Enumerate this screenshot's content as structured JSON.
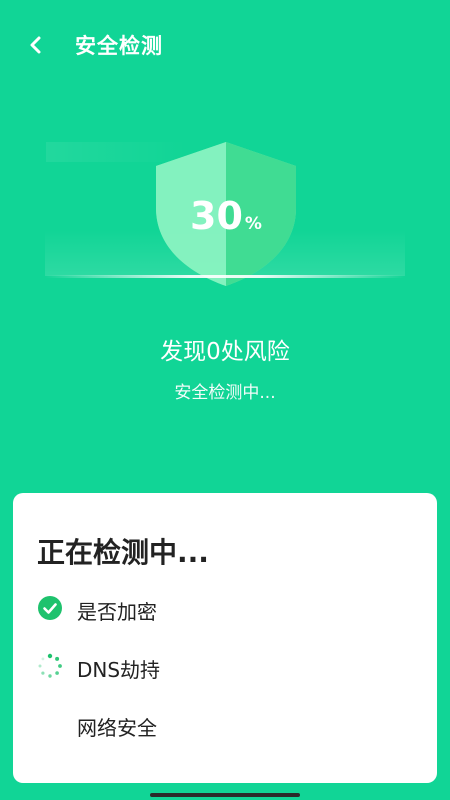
{
  "header": {
    "title": "安全检测"
  },
  "scan": {
    "progress_value": "30",
    "progress_unit": "%",
    "risk_text": "发现0处风险",
    "status_text": "安全检测中..."
  },
  "checklist": {
    "title": "正在检测中...",
    "items": [
      {
        "label": "是否加密",
        "state": "done"
      },
      {
        "label": "DNS劫持",
        "state": "in-progress"
      },
      {
        "label": "网络安全",
        "state": "pending"
      }
    ]
  },
  "colors": {
    "background": "#11d596",
    "shield_light": "#7df0b9",
    "shield_dark": "#3fd98f",
    "check": "#1ec26d"
  }
}
